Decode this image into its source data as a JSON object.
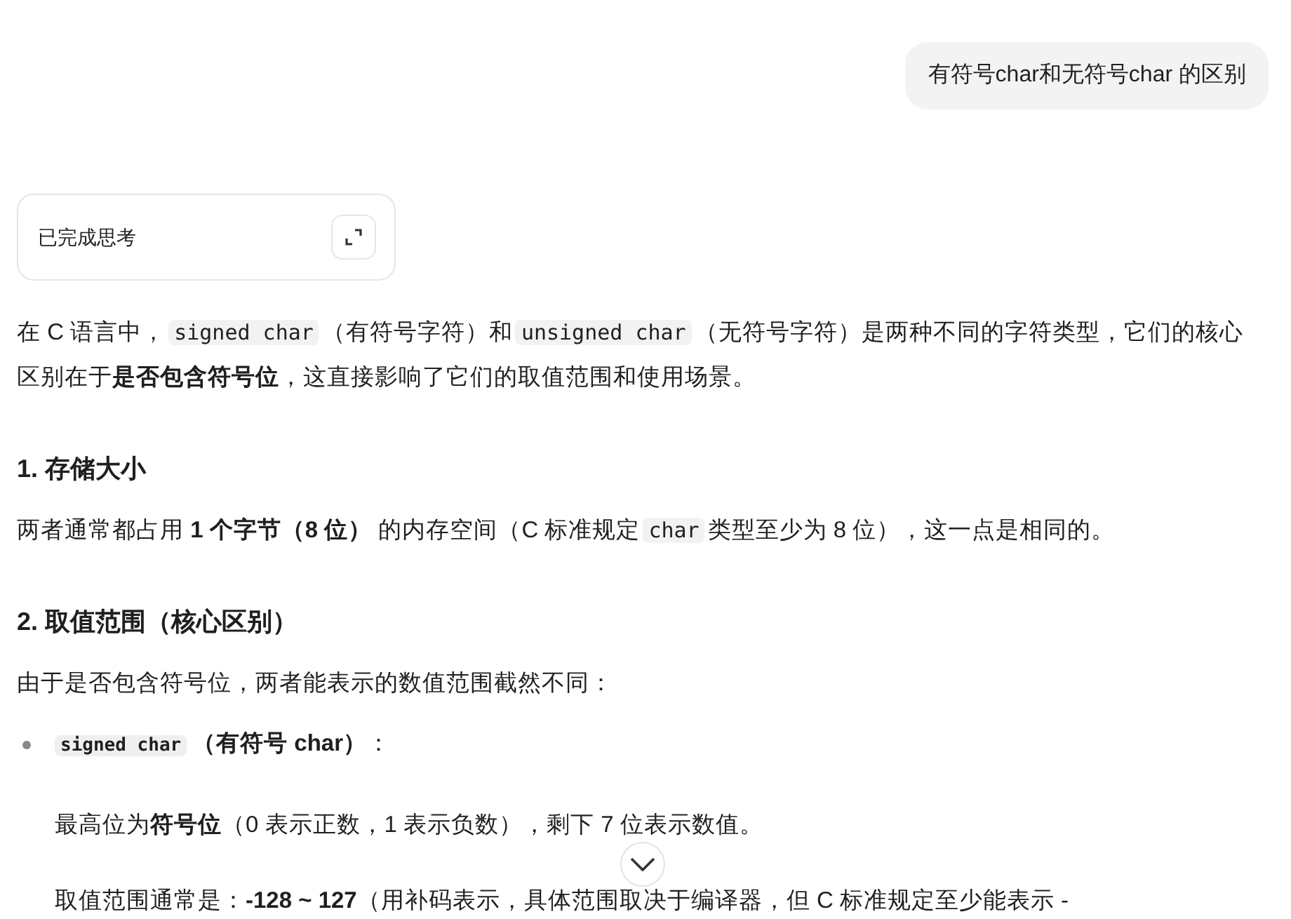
{
  "user_message": "有符号char和无符号char 的区别",
  "thinking": {
    "label": "已完成思考"
  },
  "answer": [
    {
      "kind": "para",
      "segments": [
        {
          "kind": "text",
          "text": "在 C 语言中，"
        },
        {
          "kind": "code",
          "text": "signed char"
        },
        {
          "kind": "text",
          "text": "（有符号字符）和"
        },
        {
          "kind": "code",
          "text": "unsigned char"
        },
        {
          "kind": "text",
          "text": "（无符号字符）是两种不同的字符类型，它们的核心区别在于**是否包含符号位**，这直接影响了它们的取值范围和使用场景。"
        }
      ]
    },
    {
      "kind": "heading",
      "text": "1. 存储大小"
    },
    {
      "kind": "para",
      "segments": [
        {
          "kind": "text",
          "text": "两者通常都占用 **1 个字节（8 位）** 的内存空间（C 标准规定"
        },
        {
          "kind": "code",
          "text": "char"
        },
        {
          "kind": "text",
          "text": "类型至少为 8 位），这一点是相同的。"
        }
      ]
    },
    {
      "kind": "heading",
      "text": "2. 取值范围（核心区别）"
    },
    {
      "kind": "para",
      "segments": [
        {
          "kind": "text",
          "text": "由于是否包含符号位，两者能表示的数值范围截然不同："
        }
      ]
    },
    {
      "kind": "bullet",
      "segments": [
        {
          "kind": "boldcode",
          "text": "signed char"
        },
        {
          "kind": "text",
          "text": "**（有符号 char）**："
        }
      ]
    },
    {
      "kind": "subpara",
      "segments": [
        {
          "kind": "text",
          "text": "最高位为**符号位**（0 表示正数，1 表示负数），剩下 7 位表示数值。"
        }
      ]
    },
    {
      "kind": "subpara",
      "segments": [
        {
          "kind": "text",
          "text": "取值范围通常是：**-128 ~ 127**（用补码表示，具体范围取决于编译器，但 C 标准规定至少能表示 -"
        }
      ]
    }
  ]
}
